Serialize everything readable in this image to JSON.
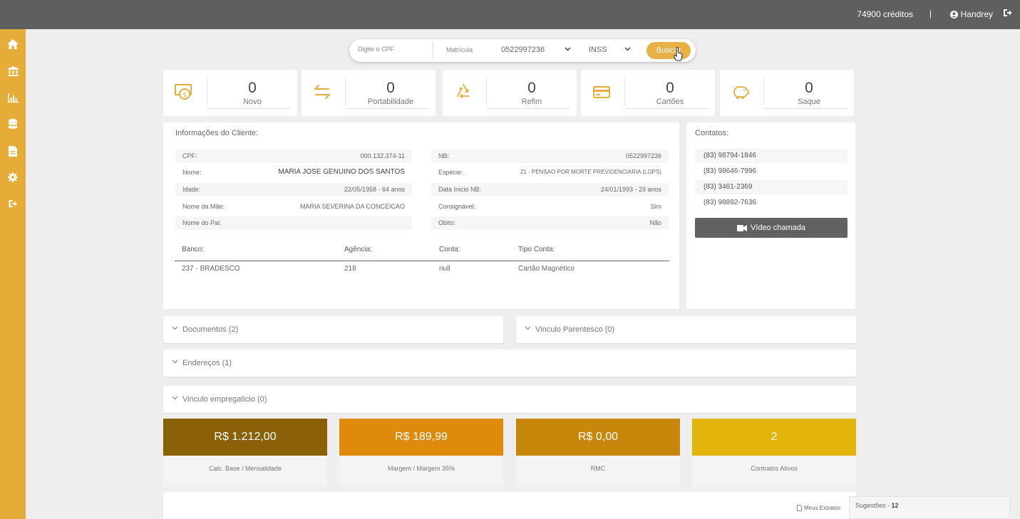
{
  "topbar": {
    "credits": "74900 créditos",
    "separator": "|",
    "user": "Handrey"
  },
  "sidebar": {
    "icons": [
      "home-icon",
      "bank-icon",
      "chart-icon",
      "database-icon",
      "document-icon",
      "gear-icon",
      "logout-icon"
    ]
  },
  "search": {
    "cpf_placeholder": "Digite o CPF",
    "matricula_label": "Matrícula",
    "matricula_value": "0522997236",
    "org_value": "INSS",
    "button": "Buscar"
  },
  "stats": [
    {
      "value": "0",
      "label": "Novo",
      "icon": "money-icon"
    },
    {
      "value": "0",
      "label": "Portabilidade",
      "icon": "transfer-arrows-icon"
    },
    {
      "value": "0",
      "label": "Refim",
      "icon": "recycle-icon"
    },
    {
      "value": "0",
      "label": "Cartões",
      "icon": "credit-card-icon"
    },
    {
      "value": "0",
      "label": "Saque",
      "icon": "piggy-bank-icon"
    }
  ],
  "client": {
    "title": "Informações do Cliente:",
    "left": [
      {
        "k": "CPF:",
        "v": "000.132.374-11"
      },
      {
        "k": "Nome:",
        "v": "MARIA JOSE GENUINO DOS SANTOS"
      },
      {
        "k": "Idade:",
        "v": "22/05/1958 - 64 anos"
      },
      {
        "k": "Nome da Mãe:",
        "v": "MARIA SEVERINA DA CONCEICAO"
      },
      {
        "k": "Nome do Pai:",
        "v": ""
      }
    ],
    "right": [
      {
        "k": "NB:",
        "v": "0522997236"
      },
      {
        "k": "Espécie:",
        "v": "21 - PENSAO POR MORTE PREVIDENCIARIA (LOPS)"
      },
      {
        "k": "Data Inicio NB:",
        "v": "24/01/1993 - 29 anos"
      },
      {
        "k": "Consignável:",
        "v": "Sim"
      },
      {
        "k": "Obito:",
        "v": "Não"
      }
    ],
    "bank": {
      "headers": [
        "Banco:",
        "Agência:",
        "Conta:",
        "Tipo Conta:"
      ],
      "values": [
        "237 - BRADESCO",
        "218",
        "null",
        "Cartão Magnético"
      ]
    }
  },
  "contacts": {
    "title": "Contatos:",
    "phones": [
      "(83) 98794-1846",
      "(83) 98646-7996",
      "(83) 3461-2369",
      "(83) 98892-7636"
    ],
    "video_button": "Vídeo chamada"
  },
  "accordions": {
    "documentos": "Documentos (2)",
    "vinculo_parentesco": "Vinculo Parentesco (0)",
    "enderecos": "Endereços (1)",
    "vinculo_empregaticio": "Vinculo empregaticio (0)"
  },
  "metrics": [
    {
      "value": "R$ 1.212,00",
      "label": "Calc. Base / Mensalidade",
      "color": "#8b6108"
    },
    {
      "value": "R$ 189,99",
      "label": "Margem / Margem 35%",
      "color": "#e08a0c"
    },
    {
      "value": "R$ 0,00",
      "label": "RMC",
      "color": "#c6870b"
    },
    {
      "value": "2",
      "label": "Contratos Ativos",
      "color": "#e2b40c"
    }
  ],
  "footer": {
    "extratos": "Meus Extratos",
    "sugestoes_label": "Sugestões - ",
    "sugestoes_count": "12"
  },
  "colors": {
    "accent": "#e6ac38",
    "topbar": "#5f5f5f"
  }
}
